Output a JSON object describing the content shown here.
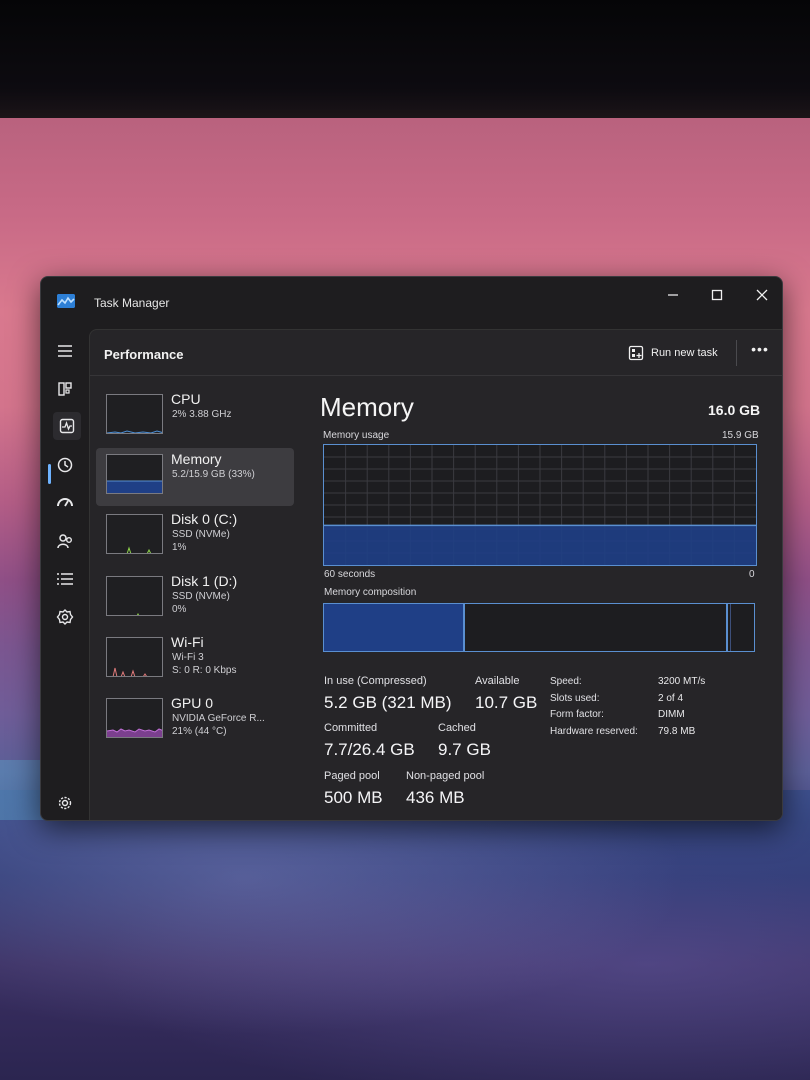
{
  "window": {
    "title": "Task Manager"
  },
  "controls": {
    "minimize": "—",
    "maximize": "☐",
    "close": "✕"
  },
  "header": {
    "title": "Performance",
    "run_new_task": "Run new task",
    "more": "•••"
  },
  "resources": [
    {
      "name": "CPU",
      "line1": "2% 3.88 GHz",
      "line2": ""
    },
    {
      "name": "Memory",
      "line1": "5.2/15.9 GB (33%)",
      "line2": ""
    },
    {
      "name": "Disk 0 (C:)",
      "line1": "SSD (NVMe)",
      "line2": "1%"
    },
    {
      "name": "Disk 1 (D:)",
      "line1": "SSD (NVMe)",
      "line2": "0%"
    },
    {
      "name": "Wi-Fi",
      "line1": "Wi-Fi 3",
      "line2": "S: 0 R: 0 Kbps"
    },
    {
      "name": "GPU 0",
      "line1": "NVIDIA GeForce R...",
      "line2": "21% (44 °C)"
    }
  ],
  "detail": {
    "title": "Memory",
    "total": "16.0 GB",
    "usage_label": "Memory usage",
    "usage_max": "15.9 GB",
    "usage_fraction": 0.33,
    "time_left": "60 seconds",
    "time_right": "0",
    "composition_label": "Memory composition",
    "stats": {
      "in_use_label": "In use (Compressed)",
      "in_use_value": "5.2 GB (321 MB)",
      "available_label": "Available",
      "available_value": "10.7 GB",
      "committed_label": "Committed",
      "committed_value": "7.7/26.4 GB",
      "cached_label": "Cached",
      "cached_value": "9.7 GB",
      "paged_label": "Paged pool",
      "paged_value": "500 MB",
      "nonpaged_label": "Non-paged pool",
      "nonpaged_value": "436 MB"
    },
    "specs": {
      "speed_label": "Speed:",
      "speed_value": "3200 MT/s",
      "slots_label": "Slots used:",
      "slots_value": "2 of 4",
      "form_label": "Form factor:",
      "form_value": "DIMM",
      "reserved_label": "Hardware reserved:",
      "reserved_value": "79.8 MB"
    }
  },
  "colors": {
    "accent": "#6fb3ff",
    "memory_fill": "#1f3f86",
    "memory_line": "#5a8fd0",
    "cpu_line": "#4c8fd6",
    "disk_line": "#8dd14a",
    "wifi_line": "#e07a7a",
    "gpu_line": "#c270d8"
  },
  "icons": {
    "app": "task-manager-icon",
    "nav": [
      "hamburger-menu-icon",
      "processes-icon",
      "performance-icon",
      "app-history-icon",
      "startup-apps-icon",
      "users-icon",
      "details-icon",
      "services-icon",
      "settings-icon"
    ]
  }
}
